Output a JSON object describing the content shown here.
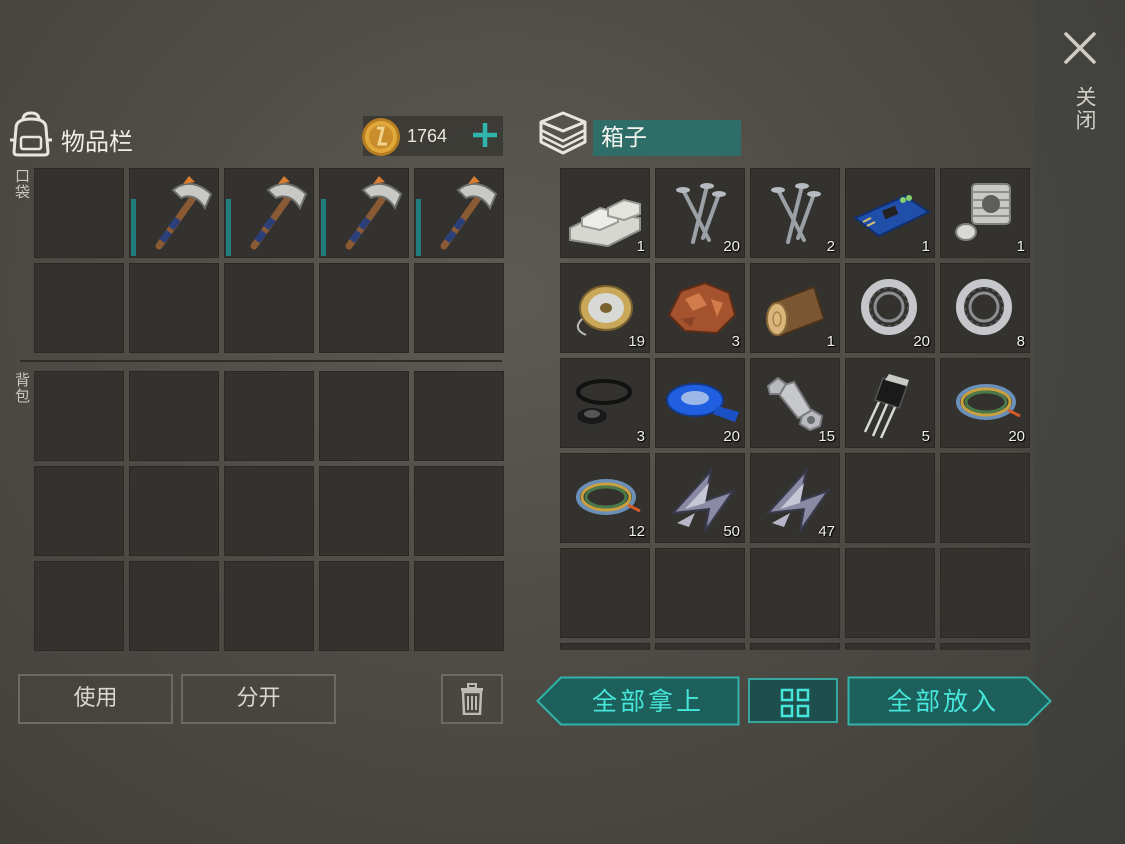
{
  "window": {
    "close_label": "关闭"
  },
  "inventory": {
    "title": "物品栏",
    "coins": "1764",
    "pocket_label": "口袋",
    "backpack_label": "背包",
    "pocket_slots": [
      {
        "item": null
      },
      {
        "item": "pickaxe-icon",
        "durability": 0.65
      },
      {
        "item": "pickaxe-icon",
        "durability": 0.65
      },
      {
        "item": "pickaxe-icon",
        "durability": 0.65
      },
      {
        "item": "pickaxe-icon",
        "durability": 0.65
      },
      {
        "item": null
      },
      {
        "item": null
      },
      {
        "item": null
      },
      {
        "item": null
      },
      {
        "item": null
      }
    ],
    "backpack_slot_count": 15
  },
  "chest": {
    "title": "箱子",
    "slots": [
      {
        "icon": "metal-bars-icon",
        "qty": "1"
      },
      {
        "icon": "nails-icon",
        "qty": "20"
      },
      {
        "icon": "nails-icon",
        "qty": "2"
      },
      {
        "icon": "circuit-board-icon",
        "qty": "1"
      },
      {
        "icon": "engine-cylinder-icon",
        "qty": "1"
      },
      {
        "icon": "wire-spool-icon",
        "qty": "19"
      },
      {
        "icon": "copper-ore-icon",
        "qty": "3"
      },
      {
        "icon": "wood-log-icon",
        "qty": "1"
      },
      {
        "icon": "bearing-icon",
        "qty": "20"
      },
      {
        "icon": "bearing-icon",
        "qty": "8"
      },
      {
        "icon": "rubber-seals-icon",
        "qty": "3"
      },
      {
        "icon": "blue-tape-icon",
        "qty": "20"
      },
      {
        "icon": "bolt-nut-icon",
        "qty": "15"
      },
      {
        "icon": "transistor-icon",
        "qty": "5"
      },
      {
        "icon": "wire-bundle-icon",
        "qty": "20"
      },
      {
        "icon": "wire-bundle-icon",
        "qty": "12"
      },
      {
        "icon": "metal-scrap-icon",
        "qty": "50"
      },
      {
        "icon": "metal-scrap-icon",
        "qty": "47"
      },
      {
        "icon": null,
        "qty": ""
      },
      {
        "icon": null,
        "qty": ""
      },
      {
        "icon": null,
        "qty": ""
      },
      {
        "icon": null,
        "qty": ""
      },
      {
        "icon": null,
        "qty": ""
      },
      {
        "icon": null,
        "qty": ""
      },
      {
        "icon": null,
        "qty": ""
      },
      {
        "icon": null,
        "qty": ""
      },
      {
        "icon": null,
        "qty": ""
      },
      {
        "icon": null,
        "qty": ""
      },
      {
        "icon": null,
        "qty": ""
      },
      {
        "icon": null,
        "qty": ""
      }
    ]
  },
  "buttons": {
    "use": "使用",
    "split": "分开",
    "take_all": "全部拿上",
    "put_all": "全部放入"
  },
  "colors": {
    "accent": "#2f8f89",
    "accent_text": "#46e6da",
    "slot": "#34322e",
    "durability": "#217d7c"
  }
}
